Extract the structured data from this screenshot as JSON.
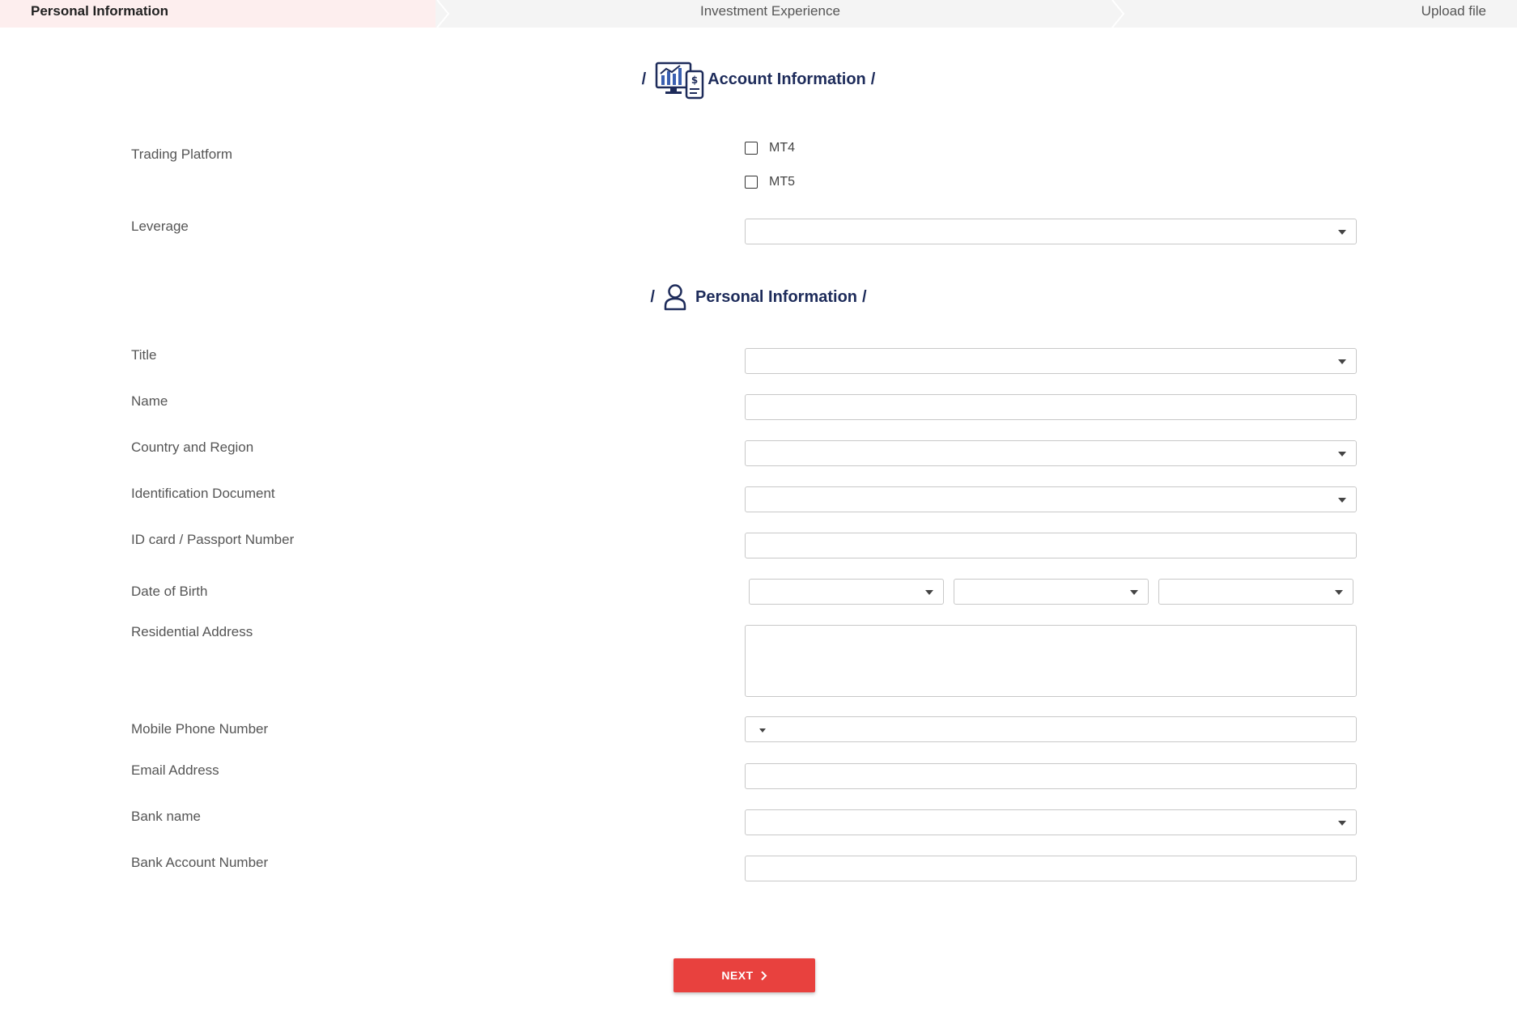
{
  "steps": [
    {
      "label": "Personal Information"
    },
    {
      "label": "Investment Experience"
    },
    {
      "label": "Upload file"
    }
  ],
  "account_section": {
    "title": "Account Information",
    "slash": "/"
  },
  "personal_section": {
    "title": "Personal Information",
    "slash": "/"
  },
  "fields": {
    "trading_platform": "Trading Platform",
    "leverage": "Leverage",
    "title": "Title",
    "name": "Name",
    "country": "Country and Region",
    "id_document": "Identification Document",
    "id_number": "ID card / Passport Number",
    "dob": "Date of Birth",
    "address": "Residential Address",
    "phone": "Mobile Phone Number",
    "email": "Email Address",
    "bank_name": "Bank name",
    "bank_account": "Bank Account Number"
  },
  "platforms": [
    "MT4",
    "MT5"
  ],
  "next_button": "NEXT",
  "colors": {
    "accent": "#e8413e",
    "heading": "#1d2b5a",
    "active_step_bg": "#fdeeee"
  }
}
